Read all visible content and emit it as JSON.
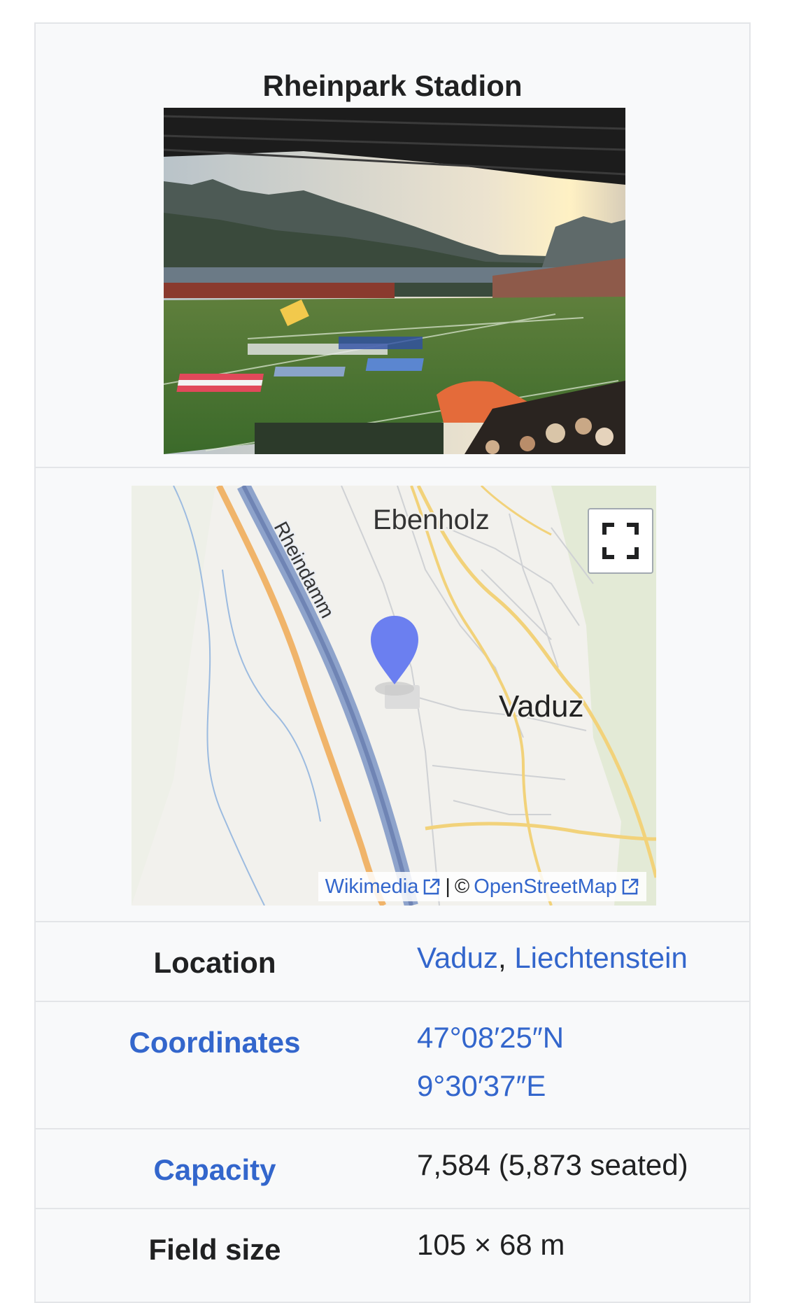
{
  "infobox": {
    "title": "Rheinpark Stadion",
    "image": {
      "alt": "Rheinpark Stadion photo"
    }
  },
  "map": {
    "labels": {
      "ebenholz": "Ebenholz",
      "rheindamm": "Rheindamm",
      "vaduz": "Vaduz"
    },
    "attribution": {
      "wikimedia": "Wikimedia",
      "separator": "|",
      "copyright": "©",
      "osm": "OpenStreetMap"
    },
    "fullscreen_icon": "fullscreen-icon",
    "marker_icon": "map-marker-icon",
    "external_link_icon": "external-link-icon"
  },
  "rows": {
    "location": {
      "label": "Location",
      "value_city": "Vaduz",
      "comma": ",",
      "value_country": "Liechtenstein"
    },
    "coordinates": {
      "label": "Coordinates",
      "lat": "47°08′25″N",
      "lon": "9°30′37″E"
    },
    "capacity": {
      "label": "Capacity",
      "value": "7,584 (5,873 seated)"
    },
    "field_size": {
      "label": "Field size",
      "value": "105 × 68 m"
    }
  },
  "colors": {
    "link": "#3366cc",
    "text": "#202122",
    "box_bg": "#f8f9fa",
    "border": "#e3e5e8",
    "marker": "#6b7ff0"
  }
}
